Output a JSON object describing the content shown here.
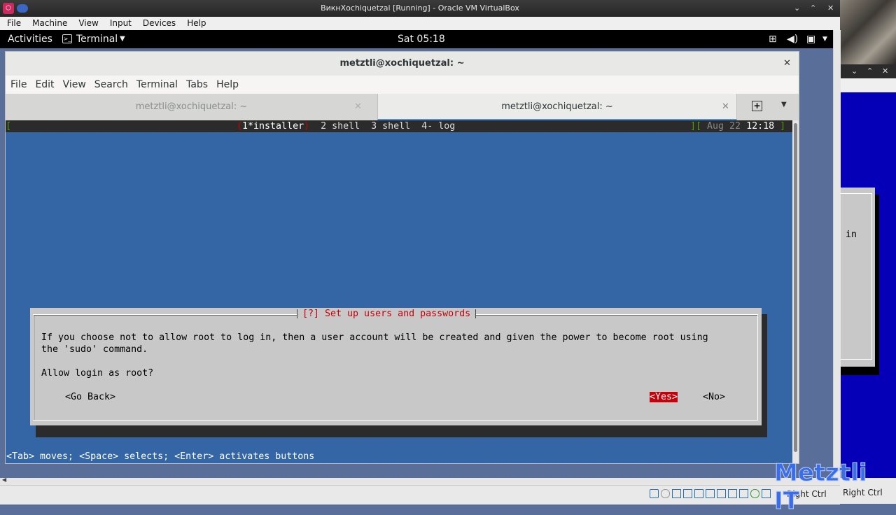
{
  "vbox": {
    "title": "ВикнXochiquetzal [Running] - Oracle VM VirtualBox",
    "menu": [
      "File",
      "Machine",
      "View",
      "Input",
      "Devices",
      "Help"
    ],
    "host_key": "Right Ctrl",
    "host_key_right": "Right Ctrl"
  },
  "gnome": {
    "activities": "Activities",
    "app_menu": "Terminal",
    "clock": "Sat 05:18"
  },
  "terminal": {
    "title": "metztli@xochiquetzal: ~",
    "menu": [
      "File",
      "Edit",
      "View",
      "Search",
      "Terminal",
      "Tabs",
      "Help"
    ],
    "tabs": [
      {
        "label": "metztli@xochiquetzal: ~",
        "active": false
      },
      {
        "label": "metztli@xochiquetzal: ~",
        "active": true
      }
    ]
  },
  "screen": {
    "bracket_open": "[",
    "win1_open": "(",
    "win1_label": "1*installer",
    "win1_close": ")",
    "windows": "  2 shell  3 shell  4- log",
    "right_open": "][",
    "date": " Aug 22 ",
    "time": "12:18",
    "right_close": " ]"
  },
  "dialog": {
    "title": "[?] Set up users and passwords",
    "line1": "If you choose not to allow root to log in, then a user account will be created and given the power to become root using",
    "line2": "the 'sudo' command.",
    "question": "Allow login as root?",
    "go_back": "<Go Back>",
    "yes": "<Yes>",
    "no": "<No>"
  },
  "help_line": "<Tab> moves; <Space> selects; <Enter> activates buttons",
  "watermark": "Metztli IT",
  "bg_window": {
    "text": "g in"
  }
}
